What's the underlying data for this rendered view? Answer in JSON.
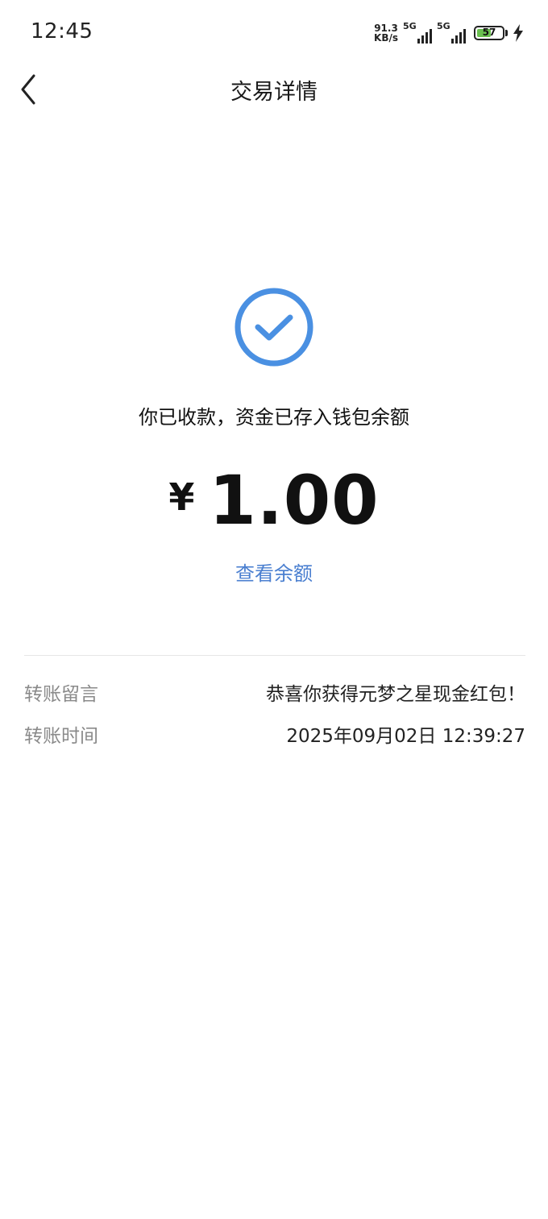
{
  "status_bar": {
    "time": "12:45",
    "net_speed_value": "91.3",
    "net_speed_unit": "KB/s",
    "signal1_label": "5G",
    "signal2_label": "5G",
    "battery_level": "57",
    "battery_percent": 57
  },
  "nav": {
    "title": "交易详情"
  },
  "result": {
    "message": "你已收款，资金已存入钱包余额",
    "currency_symbol": "¥",
    "amount": "1.00",
    "view_balance_label": "查看余额",
    "accent_color": "#4a90e2"
  },
  "details": [
    {
      "label": "转账留言",
      "value": "恭喜你获得元梦之星现金红包！"
    },
    {
      "label": "转账时间",
      "value": "2025年09月02日 12:39:27"
    }
  ]
}
